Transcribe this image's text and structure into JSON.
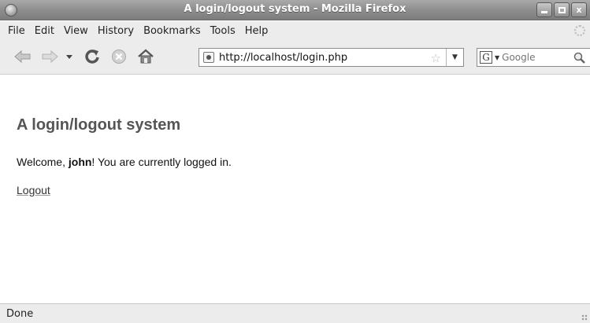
{
  "window": {
    "title": "A login/logout system - Mozilla Firefox",
    "minimize_label": "",
    "maximize_label": "",
    "close_label": "x"
  },
  "menu": {
    "items": [
      "File",
      "Edit",
      "View",
      "History",
      "Bookmarks",
      "Tools",
      "Help"
    ]
  },
  "toolbar": {
    "icons": [
      "back-icon",
      "forward-icon",
      "history-dropdown-icon",
      "reload-icon",
      "stop-icon",
      "home-icon"
    ],
    "url": "http://localhost/login.php",
    "search_placeholder": "Google",
    "search_engine_letter": "G"
  },
  "page": {
    "heading": "A login/logout system",
    "welcome_prefix": "Welcome, ",
    "username": "john",
    "welcome_suffix": "! You are currently logged in.",
    "logout_link": "Logout"
  },
  "status": {
    "text": "Done"
  }
}
